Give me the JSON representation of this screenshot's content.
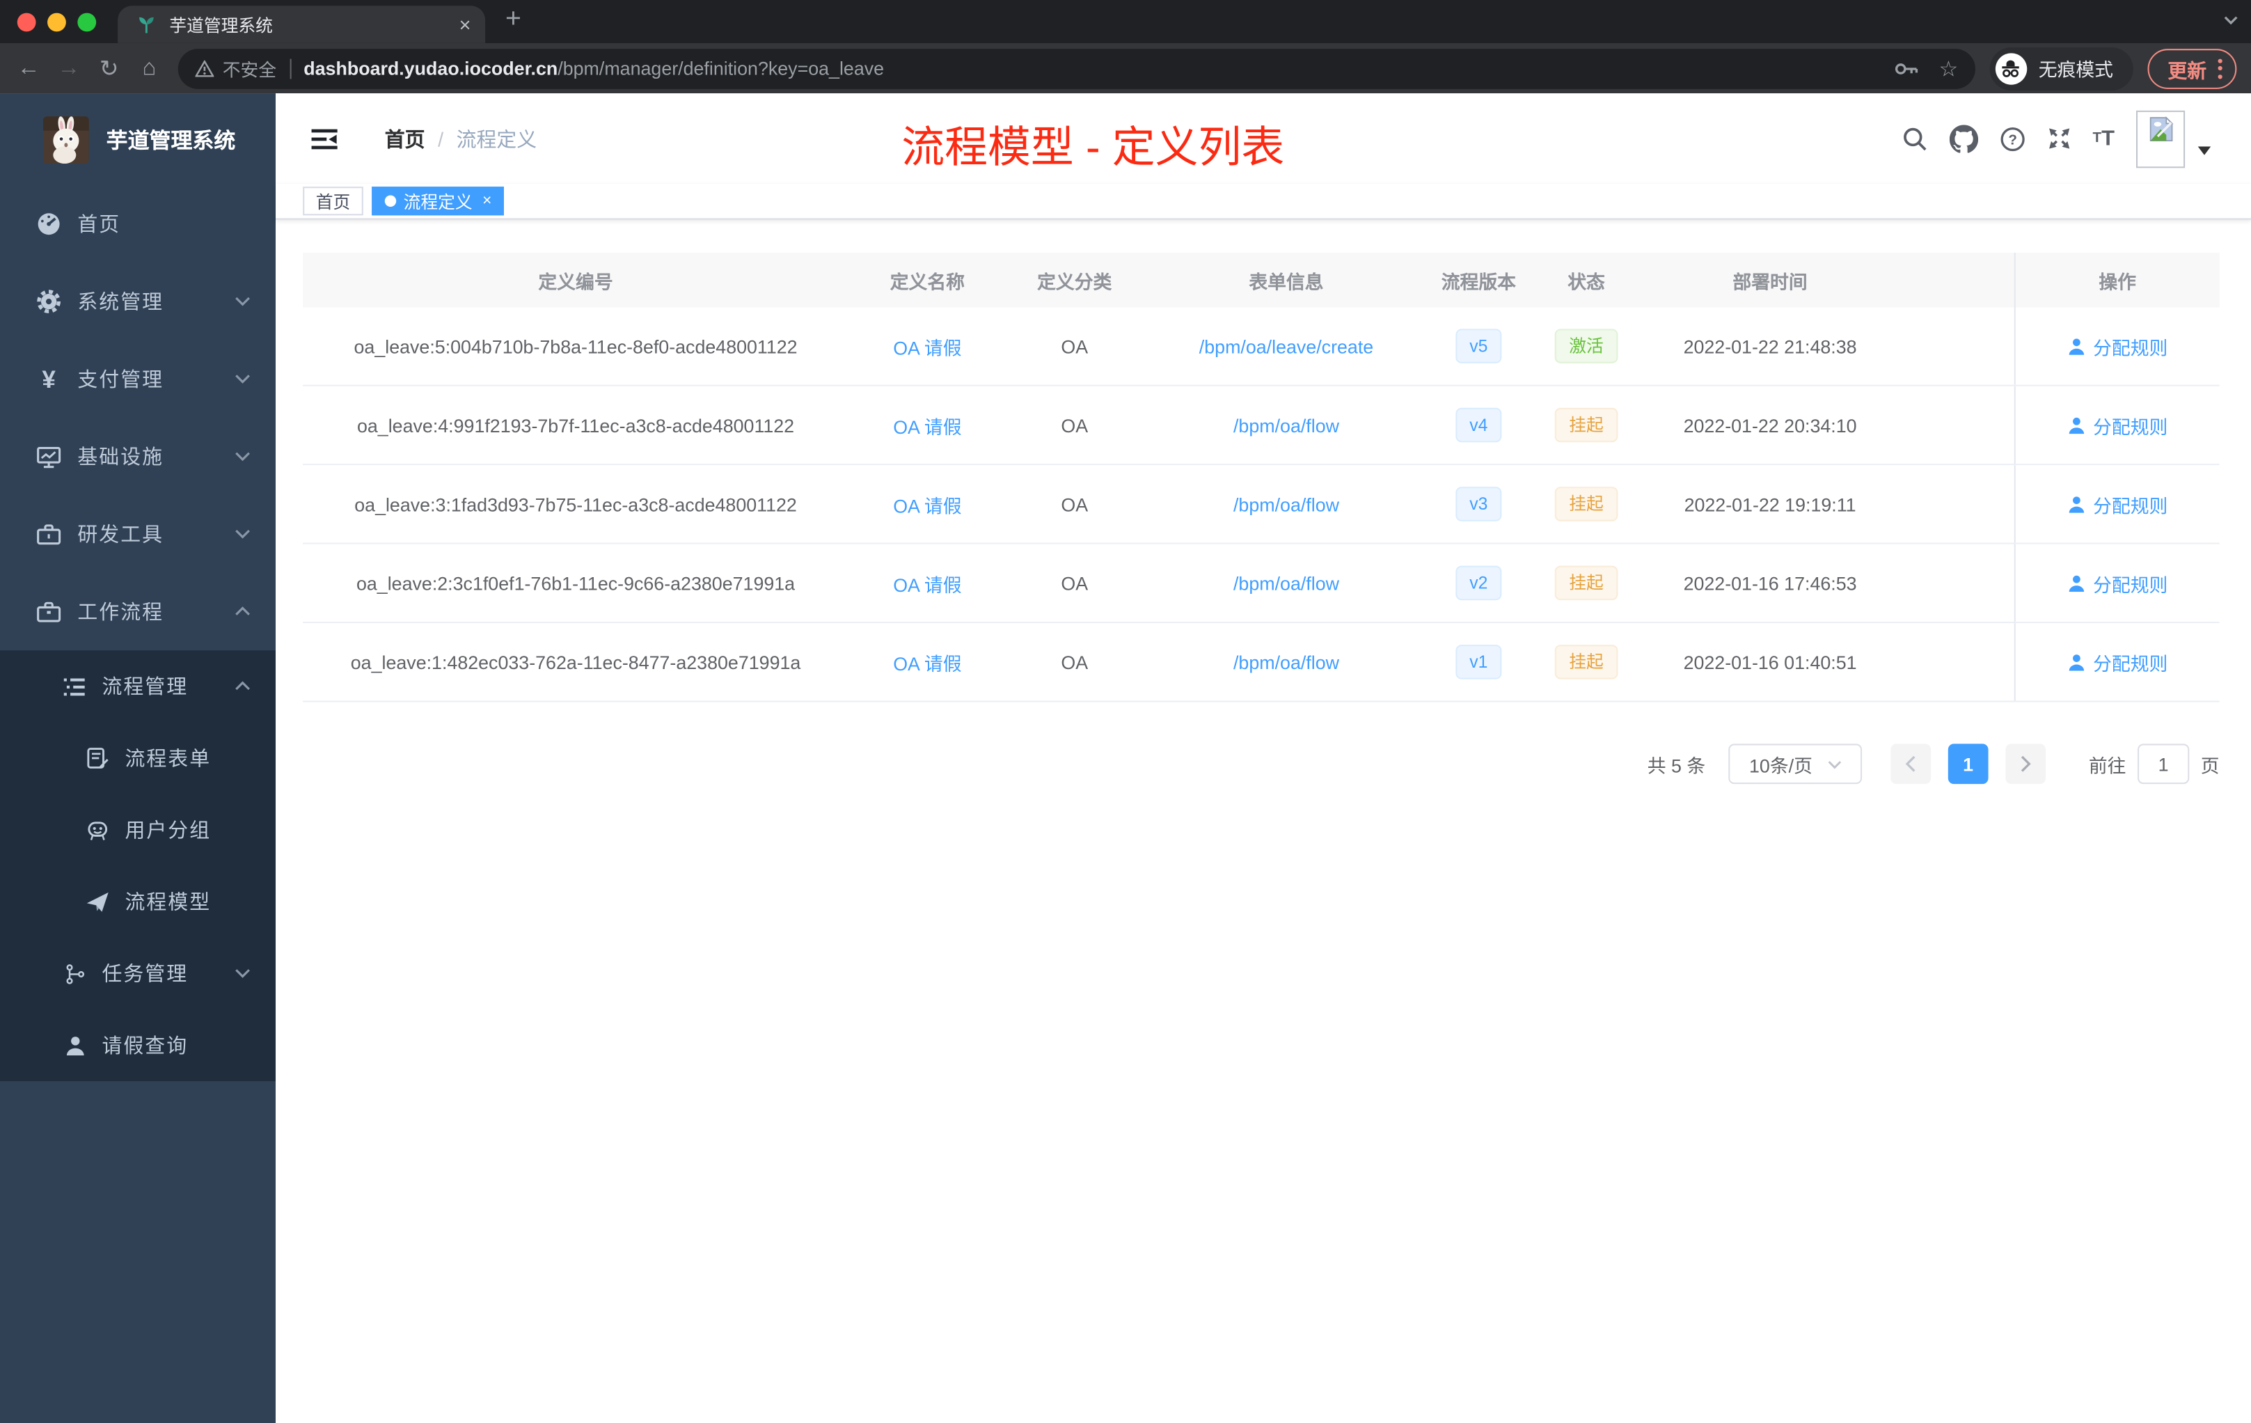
{
  "browser": {
    "tab_title": "芋道管理系统",
    "new_tab_label": "+",
    "tab_close_label": "×",
    "security_label": "不安全",
    "url_host": "dashboard.yudao.iocoder.cn",
    "url_path": "/bpm/manager/definition?key=oa_leave",
    "incognito_label": "无痕模式",
    "update_label": "更新",
    "traffic_lights": {
      "close": "#ff5f57",
      "minimize": "#febc2e",
      "maximize": "#28c840"
    }
  },
  "sidebar": {
    "brand": "芋道管理系统",
    "menu": [
      {
        "label": "首页",
        "icon": "dashboard-icon"
      },
      {
        "label": "系统管理",
        "icon": "gear-icon"
      },
      {
        "label": "支付管理",
        "icon": "yen-icon"
      },
      {
        "label": "基础设施",
        "icon": "monitor-icon"
      },
      {
        "label": "研发工具",
        "icon": "toolbox-icon"
      },
      {
        "label": "工作流程",
        "icon": "briefcase-icon"
      }
    ],
    "submenu": [
      {
        "label": "流程管理",
        "icon": "tree-list-icon"
      },
      {
        "label": "流程表单",
        "icon": "form-icon"
      },
      {
        "label": "用户分组",
        "icon": "robot-icon"
      },
      {
        "label": "流程模型",
        "icon": "paper-plane-icon"
      },
      {
        "label": "任务管理",
        "icon": "branch-icon"
      },
      {
        "label": "请假查询",
        "icon": "person-icon"
      }
    ]
  },
  "header": {
    "breadcrumb": {
      "home": "首页",
      "separator": "/",
      "current": "流程定义"
    },
    "annotation": "流程模型 - 定义列表",
    "icons": [
      "search-icon",
      "github-icon",
      "help-icon",
      "fullscreen-icon",
      "font-size-icon",
      "avatar-broken-image"
    ]
  },
  "tags": {
    "home": "首页",
    "active": "流程定义",
    "close": "×"
  },
  "table": {
    "columns": [
      "定义编号",
      "定义名称",
      "定义分类",
      "表单信息",
      "流程版本",
      "状态",
      "部署时间",
      "操作"
    ],
    "rows": [
      {
        "id": "oa_leave:5:004b710b-7b8a-11ec-8ef0-acde48001122",
        "name": "OA 请假",
        "category": "OA",
        "form": "/bpm/oa/leave/create",
        "version": "v5",
        "status": "激活",
        "status_type": "success",
        "deployed_at": "2022-01-22 21:48:38",
        "action": "分配规则"
      },
      {
        "id": "oa_leave:4:991f2193-7b7f-11ec-a3c8-acde48001122",
        "name": "OA 请假",
        "category": "OA",
        "form": "/bpm/oa/flow",
        "version": "v4",
        "status": "挂起",
        "status_type": "warning",
        "deployed_at": "2022-01-22 20:34:10",
        "action": "分配规则"
      },
      {
        "id": "oa_leave:3:1fad3d93-7b75-11ec-a3c8-acde48001122",
        "name": "OA 请假",
        "category": "OA",
        "form": "/bpm/oa/flow",
        "version": "v3",
        "status": "挂起",
        "status_type": "warning",
        "deployed_at": "2022-01-22 19:19:11",
        "action": "分配规则"
      },
      {
        "id": "oa_leave:2:3c1f0ef1-76b1-11ec-9c66-a2380e71991a",
        "name": "OA 请假",
        "category": "OA",
        "form": "/bpm/oa/flow",
        "version": "v2",
        "status": "挂起",
        "status_type": "warning",
        "deployed_at": "2022-01-16 17:46:53",
        "action": "分配规则"
      },
      {
        "id": "oa_leave:1:482ec033-762a-11ec-8477-a2380e71991a",
        "name": "OA 请假",
        "category": "OA",
        "form": "/bpm/oa/flow",
        "version": "v1",
        "status": "挂起",
        "status_type": "warning",
        "deployed_at": "2022-01-16 01:40:51",
        "action": "分配规则"
      }
    ]
  },
  "pagination": {
    "total": "共 5 条",
    "page_size": "10条/页",
    "current_page": "1",
    "goto_label": "前往",
    "goto_value": "1",
    "unit_label": "页"
  },
  "colors": {
    "accent": "#409eff",
    "success": "#67c23a",
    "warning": "#e6a23c",
    "annotation_red": "#fb2a12",
    "sidebar_bg": "#304156",
    "submenu_bg": "#1f2d3d"
  }
}
